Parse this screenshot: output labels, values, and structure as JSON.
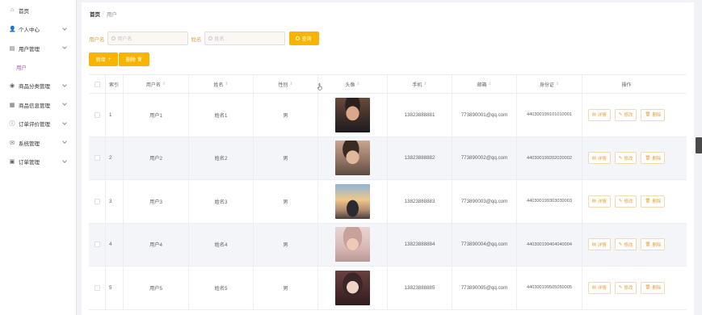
{
  "sidebar": {
    "items": [
      {
        "label": "首页",
        "icon": "home-icon",
        "glyph": "⌂",
        "chevron": false
      },
      {
        "label": "个人中心",
        "icon": "user-icon",
        "glyph": "👤",
        "chevron": true
      },
      {
        "label": "用户管理",
        "icon": "list-icon",
        "glyph": "▤",
        "chevron": true
      },
      {
        "label": "商品分类管理",
        "icon": "location-icon",
        "glyph": "◉",
        "chevron": true
      },
      {
        "label": "商品信息管理",
        "icon": "grid-icon",
        "glyph": "▦",
        "chevron": true
      },
      {
        "label": "订单评价管理",
        "icon": "info-icon",
        "glyph": "ⓘ",
        "chevron": true
      },
      {
        "label": "系统管理",
        "icon": "mail-icon",
        "glyph": "✉",
        "chevron": true
      },
      {
        "label": "订单管理",
        "icon": "cart-icon",
        "glyph": "▣",
        "chevron": true
      }
    ],
    "active_sub": "用户"
  },
  "breadcrumb": {
    "home": "首页",
    "sep": "/",
    "current": "用户"
  },
  "search": {
    "username_label": "用户名",
    "username_placeholder": "用户名",
    "name_label": "姓名",
    "name_placeholder": "姓名",
    "query_label": "查询"
  },
  "actions": {
    "add_label": "新增",
    "add_icon": "+",
    "delete_label": "删除",
    "delete_icon": "🗑"
  },
  "table": {
    "headers": [
      "索引",
      "用户名",
      "姓名",
      "性别",
      "头像",
      "手机",
      "邮箱",
      "身份证",
      "操作"
    ],
    "rows": [
      {
        "index": "1",
        "username": "用户1",
        "name": "姓名1",
        "gender": "男",
        "avatar": "av1",
        "phone": "13823888881",
        "email": "773890001@qq.com",
        "id_card": "440300199101010001"
      },
      {
        "index": "2",
        "username": "用户2",
        "name": "姓名2",
        "gender": "男",
        "avatar": "av2",
        "phone": "13823888882",
        "email": "773890002@qq.com",
        "id_card": "440300199202020002"
      },
      {
        "index": "3",
        "username": "用户3",
        "name": "姓名3",
        "gender": "男",
        "avatar": "av3",
        "phone": "13823888883",
        "email": "773890003@qq.com",
        "id_card": "440300199303030003"
      },
      {
        "index": "4",
        "username": "用户4",
        "name": "姓名4",
        "gender": "男",
        "avatar": "av4",
        "phone": "13823888884",
        "email": "773890004@qq.com",
        "id_card": "440300199404040004"
      },
      {
        "index": "5",
        "username": "用户5",
        "name": "姓名5",
        "gender": "男",
        "avatar": "av5",
        "phone": "13823888885",
        "email": "773890005@qq.com",
        "id_card": "440300199505050005"
      }
    ],
    "ops": {
      "detail": "详情",
      "edit": "修改",
      "delete": "删除"
    }
  },
  "colors": {
    "accent": "#f7b500",
    "label": "#e6a23c",
    "submenu": "#b060c8"
  }
}
